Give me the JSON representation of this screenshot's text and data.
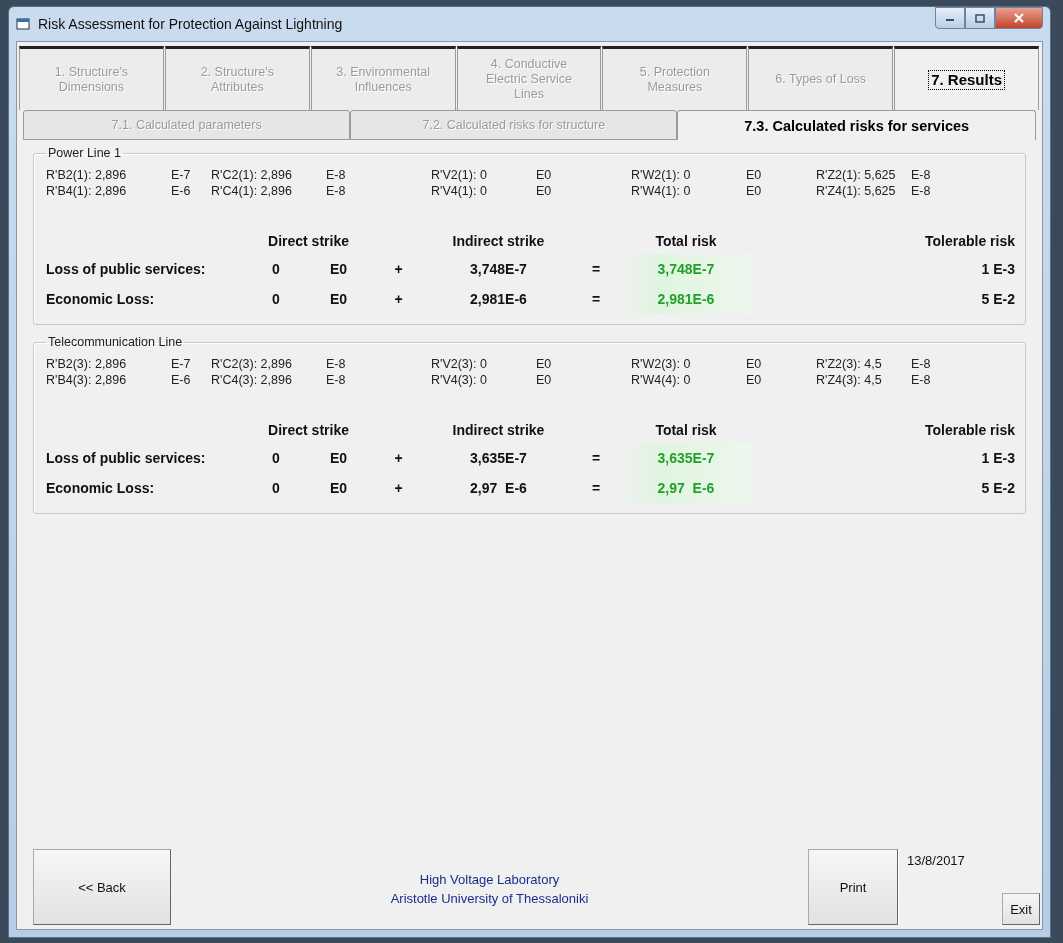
{
  "window": {
    "title": "Risk Assessment for Protection Against Lightning"
  },
  "tabs": [
    {
      "label": "1. Structure's Dimensions",
      "selected": false
    },
    {
      "label": "2. Structure's Attributes",
      "selected": false
    },
    {
      "label": "3. Environmental Influences",
      "selected": false
    },
    {
      "label": "4. Conductive Electric Service Lines",
      "selected": false
    },
    {
      "label": "5. Protection Measures",
      "selected": false
    },
    {
      "label": "6. Types of Loss",
      "selected": false
    },
    {
      "label": "7. Results",
      "selected": true
    }
  ],
  "subtabs": [
    {
      "label": "7.1. Calculated parameters",
      "selected": false
    },
    {
      "label": "7.2. Calculated risks for structure",
      "selected": false
    },
    {
      "label": "7.3. Calculated risks for services",
      "selected": true
    }
  ],
  "groups": [
    {
      "title": "Power Line 1",
      "params": [
        [
          {
            "label": "R'B2(1): 2,896",
            "exp": "E-7"
          },
          {
            "label": "R'C2(1): 2,896",
            "exp": "E-8"
          },
          {
            "label": "R'V2(1): 0",
            "exp": "E0"
          },
          {
            "label": "R'W2(1):  0",
            "exp": "E0"
          },
          {
            "label": "R'Z2(1): 5,625",
            "exp": "E-8"
          }
        ],
        [
          {
            "label": "R'B4(1): 2,896",
            "exp": "E-6"
          },
          {
            "label": "R'C4(1): 2,896",
            "exp": "E-8"
          },
          {
            "label": "R'V4(1): 0",
            "exp": "E0"
          },
          {
            "label": "R'W4(1):  0",
            "exp": "E0"
          },
          {
            "label": "R'Z4(1): 5,625",
            "exp": "E-8"
          }
        ]
      ],
      "headers": [
        "Direct strike",
        "Indirect strike",
        "Total risk",
        "Tolerable risk"
      ],
      "rows": [
        {
          "label": "Loss of public services:",
          "direct": "0",
          "direct_exp": "E0",
          "plus": "+",
          "indirect": "3,748E-7",
          "equals": "=",
          "total": "3,748E-7",
          "tolerable": "1 E-3"
        },
        {
          "label": "Economic Loss:",
          "direct": "0",
          "direct_exp": "E0",
          "plus": "+",
          "indirect": "2,981E-6",
          "equals": "=",
          "total": "2,981E-6",
          "tolerable": "5 E-2"
        }
      ]
    },
    {
      "title": "Telecommunication Line",
      "params": [
        [
          {
            "label": "R'B2(3): 2,896",
            "exp": "E-7"
          },
          {
            "label": "R'C2(3): 2,896",
            "exp": "E-8"
          },
          {
            "label": "R'V2(3): 0",
            "exp": "E0"
          },
          {
            "label": "R'W2(3):  0",
            "exp": "E0"
          },
          {
            "label": "R'Z2(3): 4,5",
            "exp": "E-8"
          }
        ],
        [
          {
            "label": "R'B4(3): 2,896",
            "exp": "E-6"
          },
          {
            "label": "R'C4(3): 2,896",
            "exp": "E-8"
          },
          {
            "label": "R'V4(3): 0",
            "exp": "E0"
          },
          {
            "label": "R'W4(4):  0",
            "exp": "E0"
          },
          {
            "label": "R'Z4(3): 4,5",
            "exp": "E-8"
          }
        ]
      ],
      "headers": [
        "Direct strike",
        "Indirect strike",
        "Total risk",
        "Tolerable risk"
      ],
      "rows": [
        {
          "label": "Loss of public services:",
          "direct": "0",
          "direct_exp": "E0",
          "plus": "+",
          "indirect": "3,635E-7",
          "equals": "=",
          "total": "3,635E-7",
          "tolerable": "1 E-3"
        },
        {
          "label": "Economic Loss:",
          "direct": "0",
          "direct_exp": "E0",
          "plus": "+",
          "indirect": "2,97  E-6",
          "equals": "=",
          "total": "2,97  E-6",
          "tolerable": "5 E-2"
        }
      ]
    }
  ],
  "footer": {
    "back": "<< Back",
    "lab": "High Voltage Laboratory",
    "university": "Aristotle University of Thessaloniki",
    "print": "Print",
    "date": "13/8/2017",
    "exit": "Exit"
  }
}
